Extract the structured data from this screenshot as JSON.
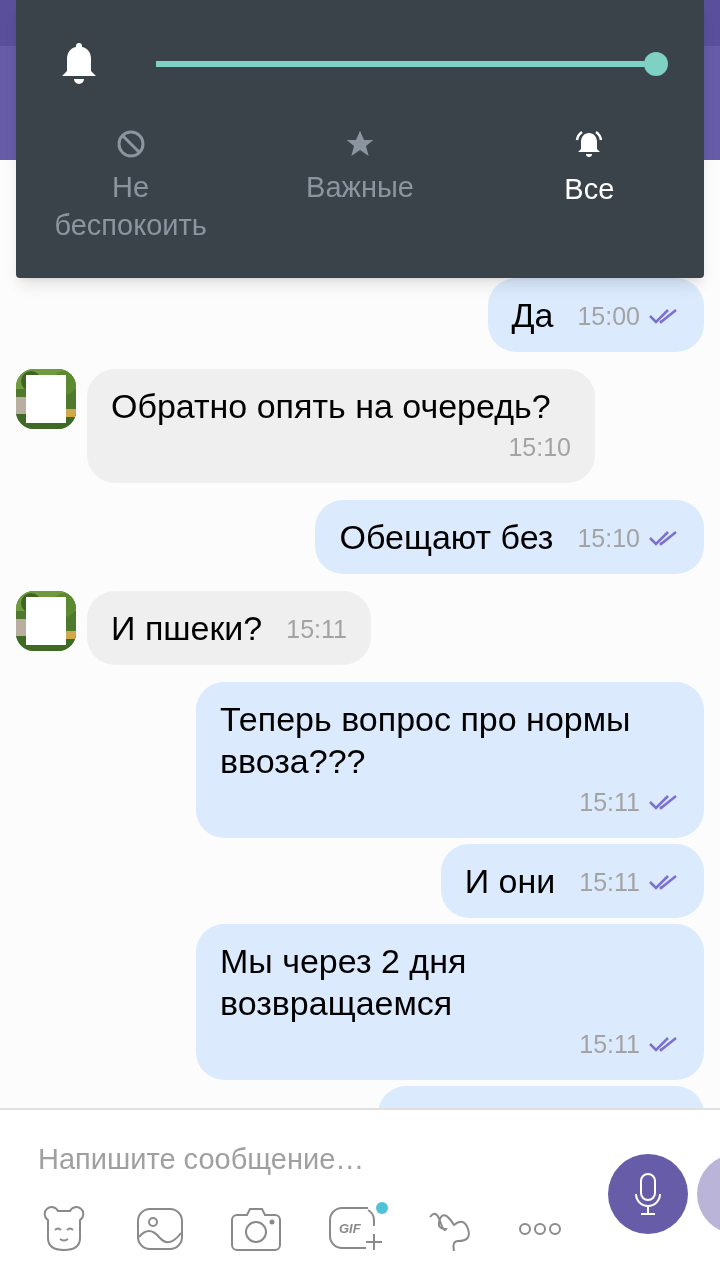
{
  "notification_panel": {
    "level": 1.0,
    "modes": [
      {
        "kind": "block",
        "label": "Не беспокоить",
        "selected": false
      },
      {
        "kind": "star",
        "label": "Важные",
        "selected": false
      },
      {
        "kind": "bell",
        "label": "Все",
        "selected": true
      }
    ]
  },
  "messages": [
    {
      "outgoing": true,
      "text": "Да",
      "time": "15:00",
      "read": true
    },
    {
      "outgoing": false,
      "text": "Обратно опять на очередь?",
      "time": "15:10"
    },
    {
      "outgoing": true,
      "text": "Обещают без",
      "time": "15:10",
      "read": true
    },
    {
      "outgoing": false,
      "text": "И пшеки?",
      "time": "15:11"
    },
    {
      "outgoing": true,
      "text": "Теперь вопрос про нормы ввоза???",
      "time": "15:11",
      "read": true
    },
    {
      "outgoing": true,
      "text": "И они",
      "time": "15:11",
      "read": true
    },
    {
      "outgoing": true,
      "text": "Мы через 2 дня возвращаемся",
      "time": "15:11",
      "read": true
    },
    {
      "outgoing": true,
      "partial": true
    }
  ],
  "composer": {
    "placeholder": "Напишите сообщение…",
    "gif_label": "GIF",
    "gif_new": true
  }
}
